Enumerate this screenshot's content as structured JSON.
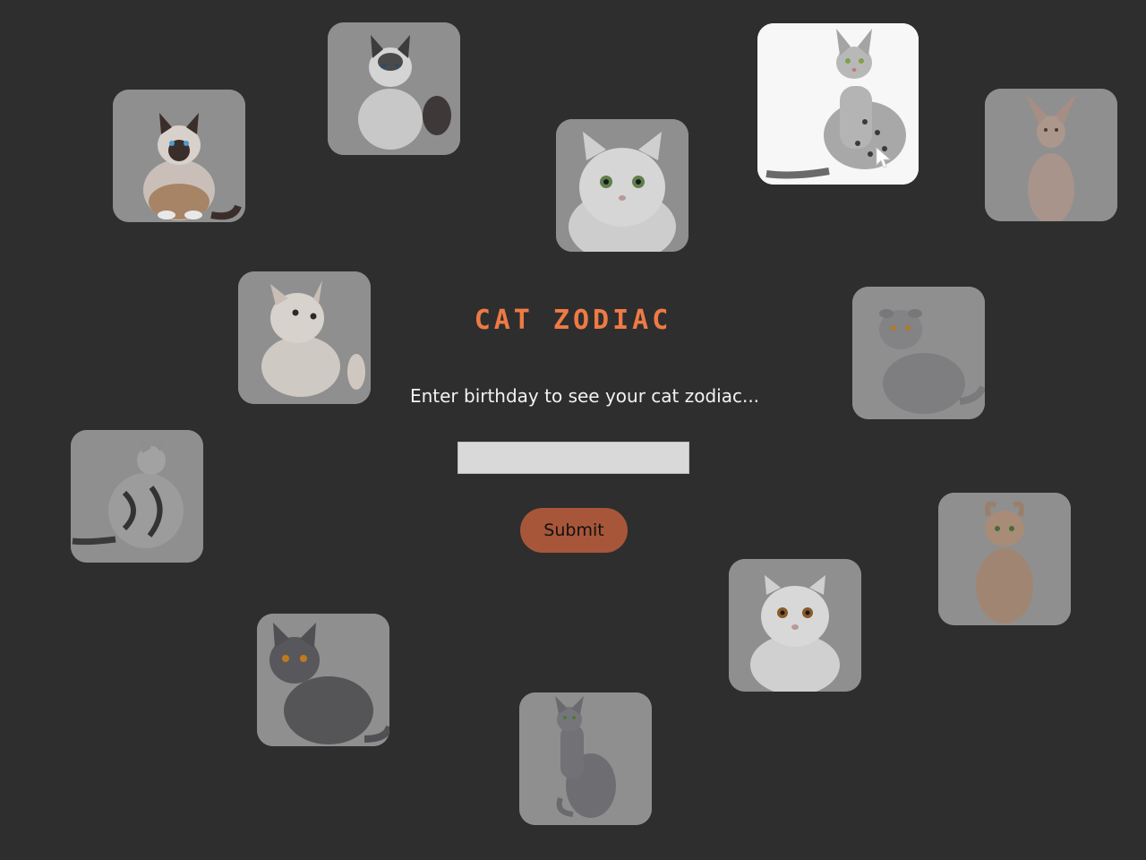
{
  "title": "CAT ZODIAC",
  "prompt": "Enter birthday to see your cat zodiac...",
  "birthday_input": {
    "value": "",
    "placeholder": ""
  },
  "submit_label": "Submit",
  "colors": {
    "background": "#2e2e2e",
    "title": "#ee7a45",
    "button": "#a8563a",
    "card_dimmed": "#8f8f8f",
    "card_active": "#f7f7f7"
  },
  "cats": [
    {
      "icon": "birman-cat-photo",
      "state": "dimmed"
    },
    {
      "icon": "ragdoll-cat-photo",
      "state": "dimmed"
    },
    {
      "icon": "persian-cat-photo",
      "state": "dimmed"
    },
    {
      "icon": "egyptian-mau-cat-photo",
      "state": "active"
    },
    {
      "icon": "sphynx-cat-photo",
      "state": "dimmed"
    },
    {
      "icon": "persian-kitten-photo",
      "state": "dimmed"
    },
    {
      "icon": "scottish-fold-cat-photo",
      "state": "dimmed"
    },
    {
      "icon": "american-shorthair-cat-photo",
      "state": "dimmed"
    },
    {
      "icon": "american-curl-cat-photo",
      "state": "dimmed"
    },
    {
      "icon": "exotic-shorthair-cat-photo",
      "state": "dimmed"
    },
    {
      "icon": "british-shorthair-cat-photo",
      "state": "dimmed"
    },
    {
      "icon": "russian-blue-cat-photo",
      "state": "dimmed"
    }
  ]
}
